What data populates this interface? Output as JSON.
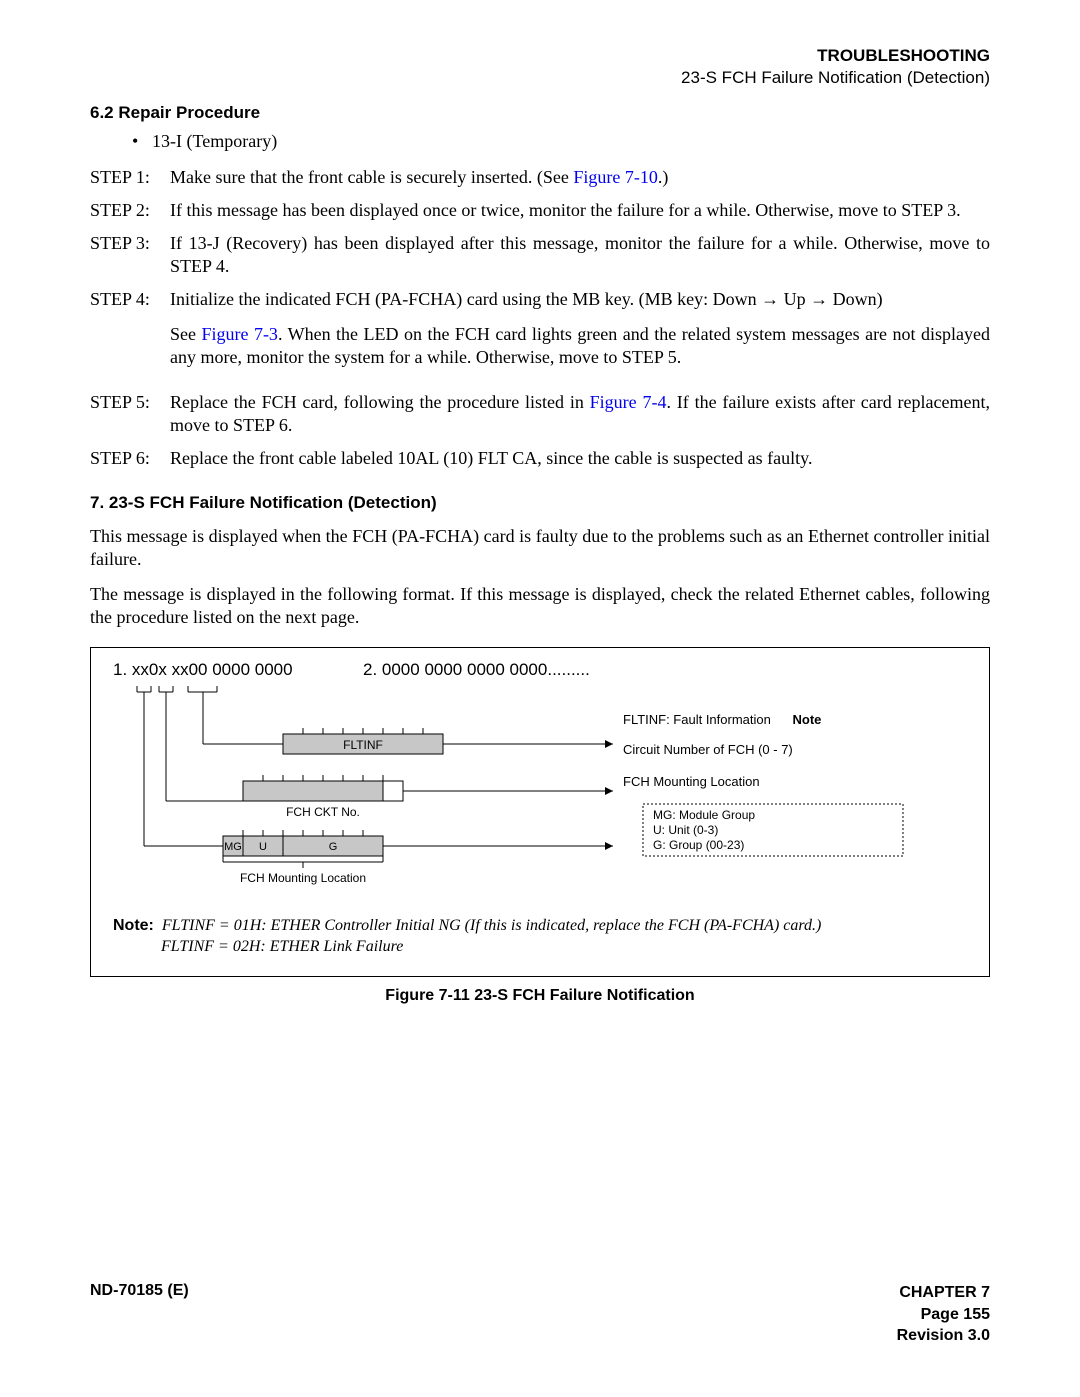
{
  "header": {
    "chapter_title": "TROUBLESHOOTING",
    "subtitle": "23-S FCH Failure Notification (Detection)"
  },
  "section_6_2": {
    "heading": "6.2   Repair Procedure",
    "bullet": "13-I (Temporary)",
    "steps": [
      {
        "label": "STEP 1:",
        "pre": "Make sure that the front cable is securely inserted. (See ",
        "link": "Figure 7-10",
        "post": ".)"
      },
      {
        "label": "STEP 2:",
        "text": "If this message has been displayed once or twice, monitor the failure for a while. Otherwise, move to STEP 3."
      },
      {
        "label": "STEP 3:",
        "text": "If 13-J (Recovery) has been displayed after this message, monitor the failure for a while. Otherwise, move to STEP 4."
      },
      {
        "label": "STEP 4:",
        "line1_pre": "Initialize the indicated FCH (PA-FCHA) card using the MB key. (MB key: Down ",
        "arrow1": "→",
        "mid1": " Up ",
        "arrow2": "→",
        "post1": " Down)",
        "line2_pre": "See ",
        "link": "Figure 7-3",
        "line2_post": ". When the LED on the FCH card lights green and the related system messages are not displayed any more, monitor the system for a while. Otherwise, move to STEP 5."
      },
      {
        "label": "STEP 5:",
        "pre": "Replace the FCH card, following the procedure listed in ",
        "link": "Figure 7-4",
        "post": ". If the failure exists after card replacement, move to STEP 6."
      },
      {
        "label": "STEP 6:",
        "text": "Replace the front cable labeled 10AL (10) FLT CA, since the cable is suspected as faulty."
      }
    ]
  },
  "section_7": {
    "heading": "7.   23-S FCH Failure Notification (Detection)",
    "para1": "This message is displayed when the FCH (PA-FCHA) card is faulty due to the problems such as an Ethernet controller initial failure.",
    "para2": "The message is displayed in the following format. If this message is displayed, check the related Ethernet cables, following the procedure listed on the next page."
  },
  "figure": {
    "line1": "1. xx0x  xx00  0000  0000",
    "line2": "2. 0000  0000  0000  0000.........",
    "svg": {
      "fltinf_label": "FLTINF",
      "fch_ckt_no": "FCH CKT No.",
      "mg": "MG",
      "u": "U",
      "g": "G",
      "fch_mount": "FCH Mounting Location",
      "right_line1_pre": "FLTINF: Fault Information",
      "right_line1_bold": "Note",
      "right_line2": "Circuit Number of FCH (0 - 7)",
      "right_line3": "FCH Mounting Location",
      "right_box_l1": "MG: Module Group",
      "right_box_l2": "U: Unit (0-3)",
      "right_box_l3": "G: Group (00-23)"
    },
    "note_label": "Note:",
    "note_line1": "FLTINF = 01H: ETHER Controller Initial NG (If this is indicated, replace the FCH (PA-FCHA) card.)",
    "note_line2": "FLTINF = 02H: ETHER Link Failure",
    "caption": "Figure 7-11   23-S FCH Failure Notification"
  },
  "footer": {
    "doc_id": "ND-70185 (E)",
    "chapter": "CHAPTER 7",
    "page": "Page 155",
    "revision": "Revision 3.0"
  }
}
